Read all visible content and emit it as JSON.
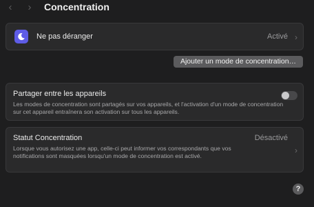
{
  "toolbar": {
    "back_icon": "chevron-left-icon",
    "forward_icon": "chevron-right-icon",
    "title": "Concentration"
  },
  "dnd": {
    "icon": "moon-icon",
    "icon_color": "#5e5ce6",
    "label": "Ne pas déranger",
    "value": "Activé"
  },
  "add_mode": {
    "label": "Ajouter un mode de concentration…"
  },
  "share": {
    "label": "Partager entre les appareils",
    "description": "Les modes de concentration sont partagés sur vos appareils, et l'activation d'un mode de concentration sur cet appareil entraînera son activation sur tous les appareils.",
    "enabled": false
  },
  "status": {
    "label": "Statut Concentration",
    "value": "Désactivé",
    "description": "Lorsque vous autorisez une app, celle-ci peut informer vos correspondants que vos notifications sont masquées lorsqu'un mode de concentration est activé."
  },
  "help": {
    "label": "?"
  }
}
